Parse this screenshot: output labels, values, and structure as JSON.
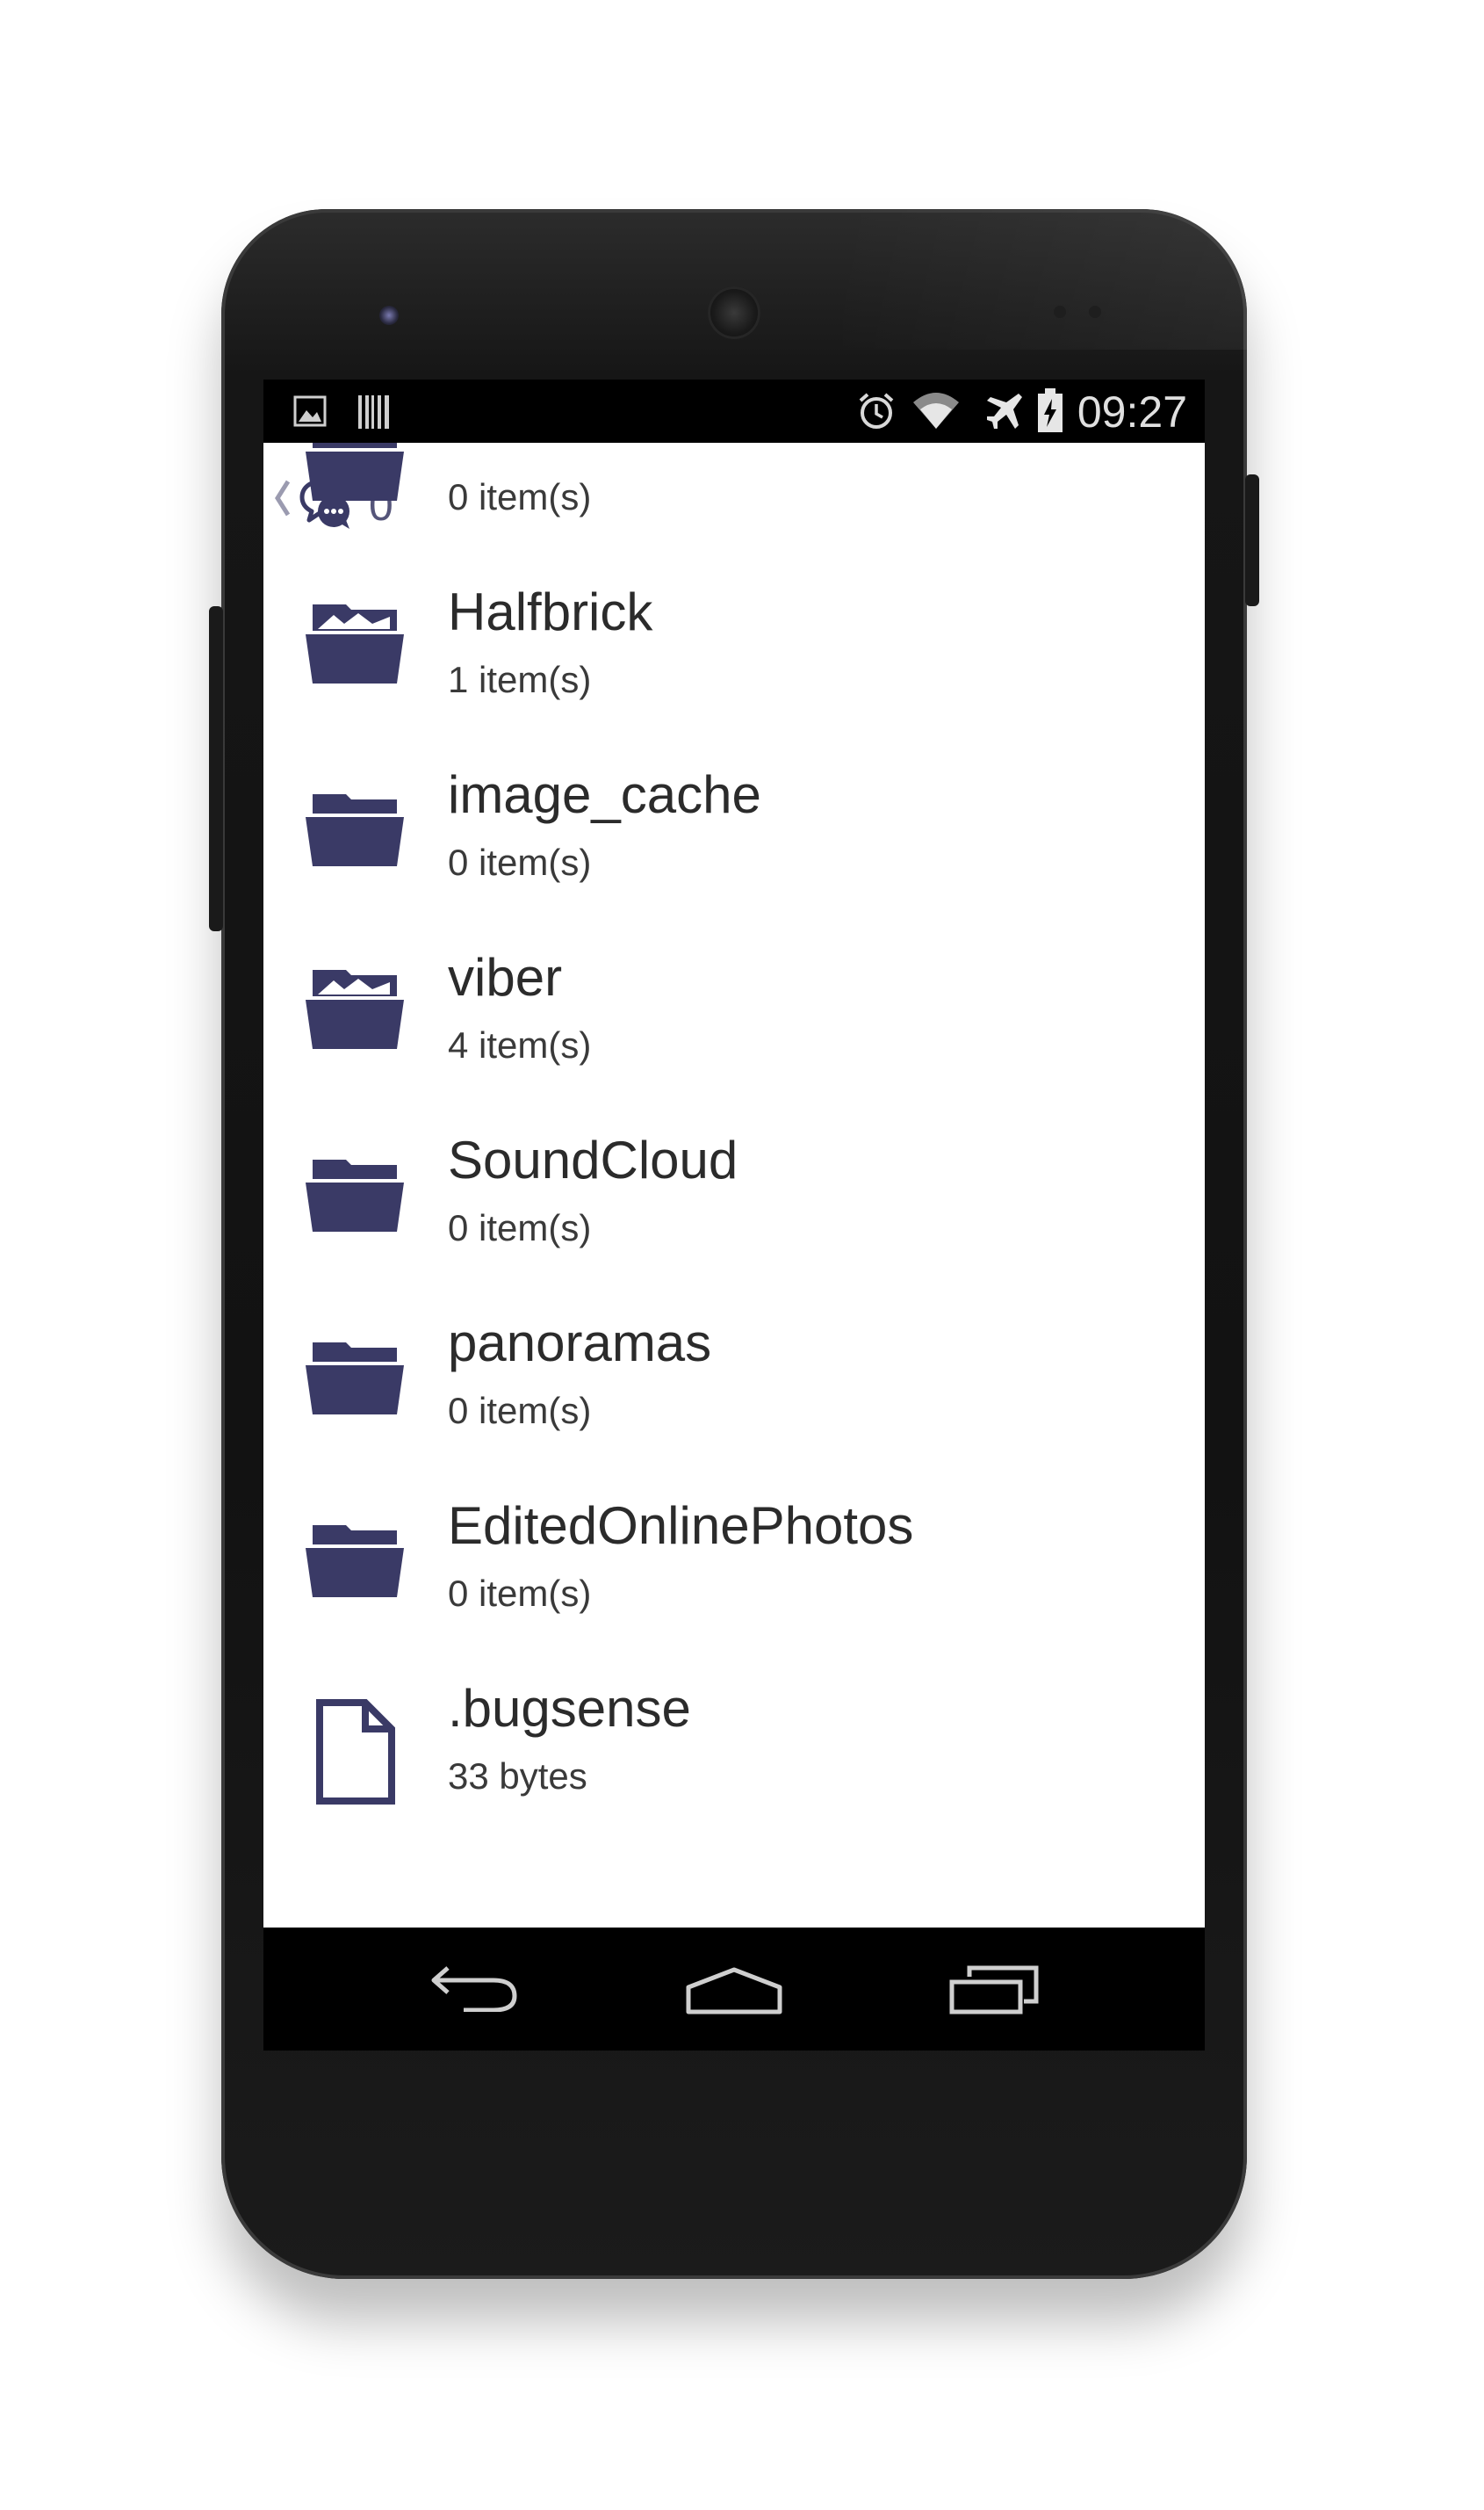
{
  "status_bar": {
    "left_icons": [
      "image-icon",
      "barcode-icon"
    ],
    "right_icons": [
      "alarm-icon",
      "wifi-icon",
      "airplane-icon",
      "battery-icon"
    ],
    "time": "09:27"
  },
  "toolbar": {
    "chat_count": "0"
  },
  "list": [
    {
      "type": "folder",
      "name": "",
      "meta": "0 item(s)",
      "icon": "folder-icon"
    },
    {
      "type": "folder-image",
      "name": "Halfbrick",
      "meta": "1 item(s)",
      "icon": "image-folder-icon"
    },
    {
      "type": "folder",
      "name": "image_cache",
      "meta": "0 item(s)",
      "icon": "folder-icon"
    },
    {
      "type": "folder-image",
      "name": "viber",
      "meta": "4 item(s)",
      "icon": "image-folder-icon"
    },
    {
      "type": "folder",
      "name": "SoundCloud",
      "meta": "0 item(s)",
      "icon": "folder-icon"
    },
    {
      "type": "folder",
      "name": "panoramas",
      "meta": "0 item(s)",
      "icon": "folder-icon"
    },
    {
      "type": "folder",
      "name": "EditedOnlinePhotos",
      "meta": "0 item(s)",
      "icon": "folder-icon"
    },
    {
      "type": "file",
      "name": ".bugsense",
      "meta": "33 bytes",
      "icon": "file-icon"
    }
  ],
  "nav_bar": {
    "buttons": [
      "back-icon",
      "home-icon",
      "recents-icon"
    ]
  },
  "colors": {
    "icon": "#3a3a66",
    "text": "#2b2b2b",
    "status_bar": "#000000",
    "nav_bar": "#000000"
  }
}
